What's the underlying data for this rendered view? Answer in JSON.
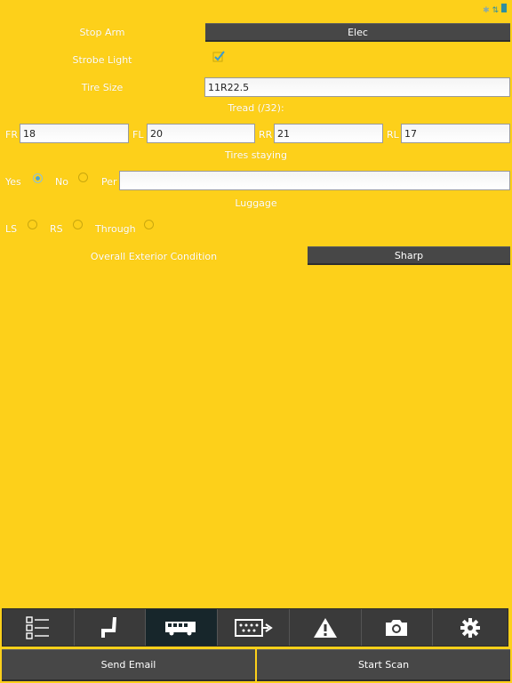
{
  "status_bar": {
    "icons": [
      "bluetooth-icon",
      "network-icon",
      "battery-icon"
    ]
  },
  "form": {
    "stop_arm": {
      "label": "Stop Arm",
      "value": "Elec"
    },
    "strobe_light": {
      "label": "Strobe Light",
      "checked": true
    },
    "tire_size": {
      "label": "Tire Size",
      "value": "11R22.5"
    },
    "tread": {
      "label": "Tread (/32):",
      "fr_label": "FR",
      "fr_value": "18",
      "fl_label": "FL",
      "fl_value": "20",
      "rr_label": "RR",
      "rr_value": "21",
      "rl_label": "RL",
      "rl_value": "17"
    },
    "tires_staying": {
      "label": "Tires staying",
      "yes_label": "Yes",
      "no_label": "No",
      "per_label": "Per",
      "selected": "Yes",
      "per_value": ""
    },
    "luggage": {
      "label": "Luggage",
      "ls_label": "LS",
      "rs_label": "RS",
      "through_label": "Through",
      "selected": ""
    },
    "exterior": {
      "label": "Overall Exterior Condition",
      "value": "Sharp"
    }
  },
  "tabs": [
    {
      "icon": "checklist-icon",
      "active": false
    },
    {
      "icon": "seat-icon",
      "active": false
    },
    {
      "icon": "bus-icon",
      "active": true
    },
    {
      "icon": "engine-icon",
      "active": false
    },
    {
      "icon": "warning-icon",
      "active": false
    },
    {
      "icon": "camera-icon",
      "active": false
    },
    {
      "icon": "gear-icon",
      "active": false
    }
  ],
  "actions": {
    "send_email": "Send Email",
    "start_scan": "Start Scan"
  }
}
